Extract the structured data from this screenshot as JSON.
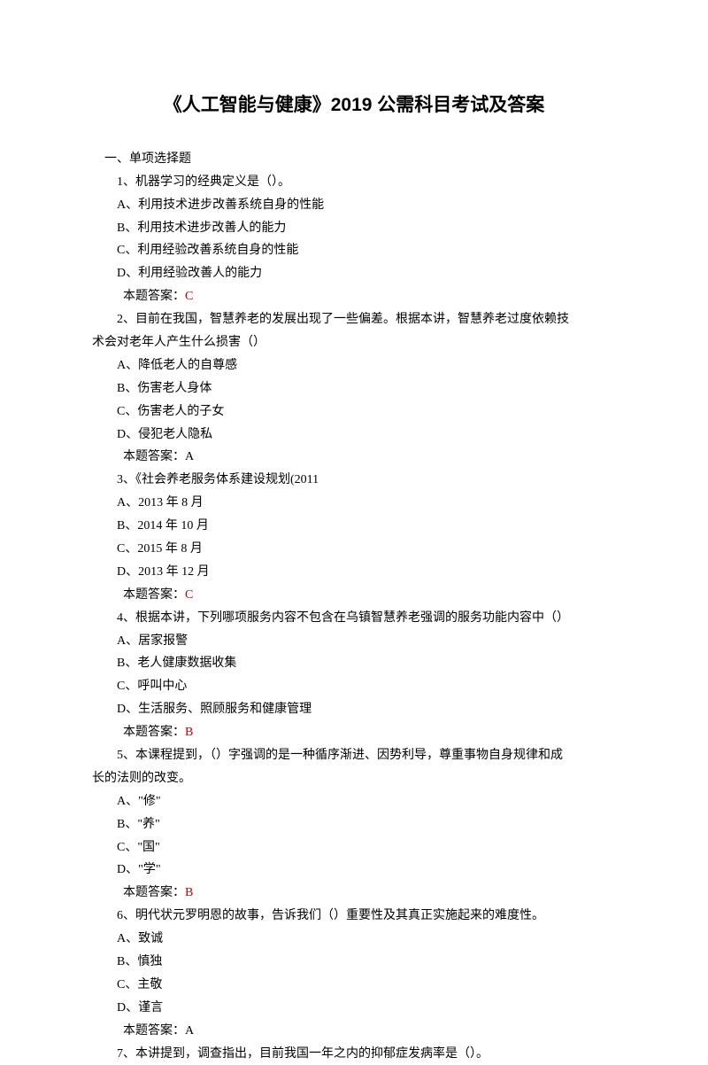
{
  "title": "《人工智能与健康》2019 公需科目考试及答案",
  "sectionHeading": "一、单项选择题",
  "q1": {
    "stem": "1、机器学习的经典定义是（）。",
    "A": "A、利用技术进步改善系统自身的性能",
    "B": "B、利用技术进步改善人的能力",
    "C": "C、利用经验改善系统自身的性能",
    "D": "D、利用经验改善人的能力",
    "ansLabel": "本题答案：",
    "ansVal": "C"
  },
  "q2": {
    "stem1": "2、目前在我国，智慧养老的发展出现了一些偏差。根据本讲，智慧养老过度依赖技",
    "stem2": "术会对老年人产生什么损害（）",
    "A": "A、降低老人的自尊感",
    "B": "B、伤害老人身体",
    "C": "C、伤害老人的子女",
    "D": "D、侵犯老人隐私",
    "ans": "本题答案：A"
  },
  "q3": {
    "stem": "3、《社会养老服务体系建设规划(2011",
    "A": "A、2013 年 8 月",
    "B": "B、2014 年 10 月",
    "C": "C、2015 年 8 月",
    "D": "D、2013 年 12 月",
    "ansLabel": "本题答案：",
    "ansVal": "C"
  },
  "q4": {
    "stem": "4、根据本讲，下列哪项服务内容不包含在乌镇智慧养老强调的服务功能内容中（）",
    "A": "A、居家报警",
    "B": "B、老人健康数据收集",
    "C": "C、呼叫中心",
    "D": "D、生活服务、照顾服务和健康管理",
    "ansLabel": "本题答案：",
    "ansVal": "B"
  },
  "q5": {
    "stem1": "5、本课程提到，（）字强调的是一种循序渐进、因势利导，尊重事物自身规律和成",
    "stem2": "长的法则的改变。",
    "A": "A、\"修\"",
    "B": "B、\"养\"",
    "C": "C、\"国\"",
    "D": "D、\"学\"",
    "ansLabel": "本题答案：",
    "ansVal": "B"
  },
  "q6": {
    "stem": "6、明代状元罗明恩的故事，告诉我们（）重要性及其真正实施起来的难度性。",
    "A": "A、致诚",
    "B": "B、慎独",
    "C": "C、主敬",
    "D": "D、谨言",
    "ans": "本题答案：A"
  },
  "q7": {
    "stem": "7、本讲提到，调查指出，目前我国一年之内的抑郁症发病率是（）。"
  }
}
